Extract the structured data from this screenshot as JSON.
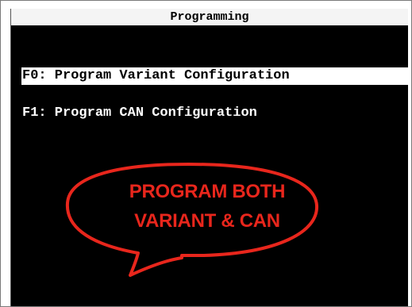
{
  "window": {
    "title": "Programming"
  },
  "menu": {
    "items": [
      {
        "label": "F0: Program Variant Configuration",
        "selected": true
      },
      {
        "label": "F1: Program CAN Configuration",
        "selected": false
      }
    ]
  },
  "annotation": {
    "line1": "PROGRAM BOTH",
    "line2": "VARIANT & CAN",
    "color": "#e8261c"
  },
  "colors": {
    "terminal_background": "#000000",
    "terminal_text": "#ffffff",
    "selection_background": "#ffffff",
    "selection_text": "#000000"
  }
}
